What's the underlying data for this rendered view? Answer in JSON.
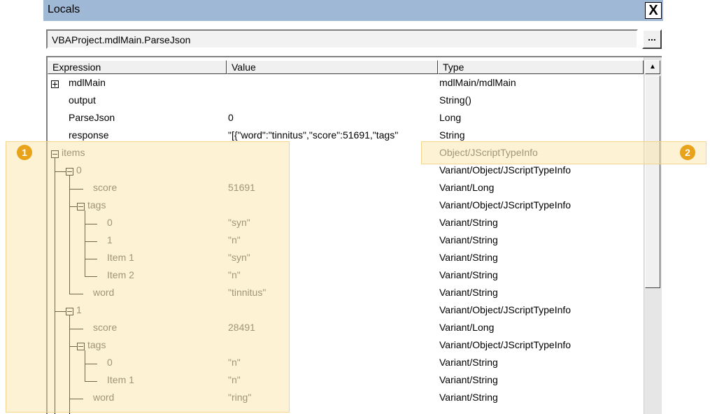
{
  "window": {
    "title": "Locals",
    "close_label": "X"
  },
  "context": {
    "value": "VBAProject.mdlMain.ParseJson",
    "button_label": "..."
  },
  "columns": {
    "expression": "Expression",
    "value": "Value",
    "type": "Type"
  },
  "rows": [
    {
      "expression": "mdlMain",
      "value": "",
      "type": "mdlMain/mdlMain"
    },
    {
      "expression": "output",
      "value": "",
      "type": "String()"
    },
    {
      "expression": "ParseJson",
      "value": "0",
      "type": "Long"
    },
    {
      "expression": "response",
      "value": "\"[{\"word\":\"tinnitus\",\"score\":51691,\"tags\"",
      "type": "String"
    },
    {
      "expression": "items",
      "value": "",
      "type": "Object/JScriptTypeInfo"
    },
    {
      "expression": "0",
      "value": "",
      "type": "Variant/Object/JScriptTypeInfo"
    },
    {
      "expression": "score",
      "value": "51691",
      "type": "Variant/Long"
    },
    {
      "expression": "tags",
      "value": "",
      "type": "Variant/Object/JScriptTypeInfo"
    },
    {
      "expression": "0",
      "value": "\"syn\"",
      "type": "Variant/String"
    },
    {
      "expression": "1",
      "value": "\"n\"",
      "type": "Variant/String"
    },
    {
      "expression": "Item 1",
      "value": "\"syn\"",
      "type": "Variant/String"
    },
    {
      "expression": "Item 2",
      "value": "\"n\"",
      "type": "Variant/String"
    },
    {
      "expression": "word",
      "value": "\"tinnitus\"",
      "type": "Variant/String"
    },
    {
      "expression": "1",
      "value": "",
      "type": "Variant/Object/JScriptTypeInfo"
    },
    {
      "expression": "score",
      "value": "28491",
      "type": "Variant/Long"
    },
    {
      "expression": "tags",
      "value": "",
      "type": "Variant/Object/JScriptTypeInfo"
    },
    {
      "expression": "0",
      "value": "\"n\"",
      "type": "Variant/String"
    },
    {
      "expression": "Item 1",
      "value": "\"n\"",
      "type": "Variant/String"
    },
    {
      "expression": "word",
      "value": "\"ring\"",
      "type": "Variant/String"
    }
  ],
  "callouts": {
    "badge1": "1",
    "badge2": "2"
  },
  "colors": {
    "titlebar": "#9fb8d6",
    "highlight": "#fae4a0",
    "badge": "#e8a31a"
  }
}
